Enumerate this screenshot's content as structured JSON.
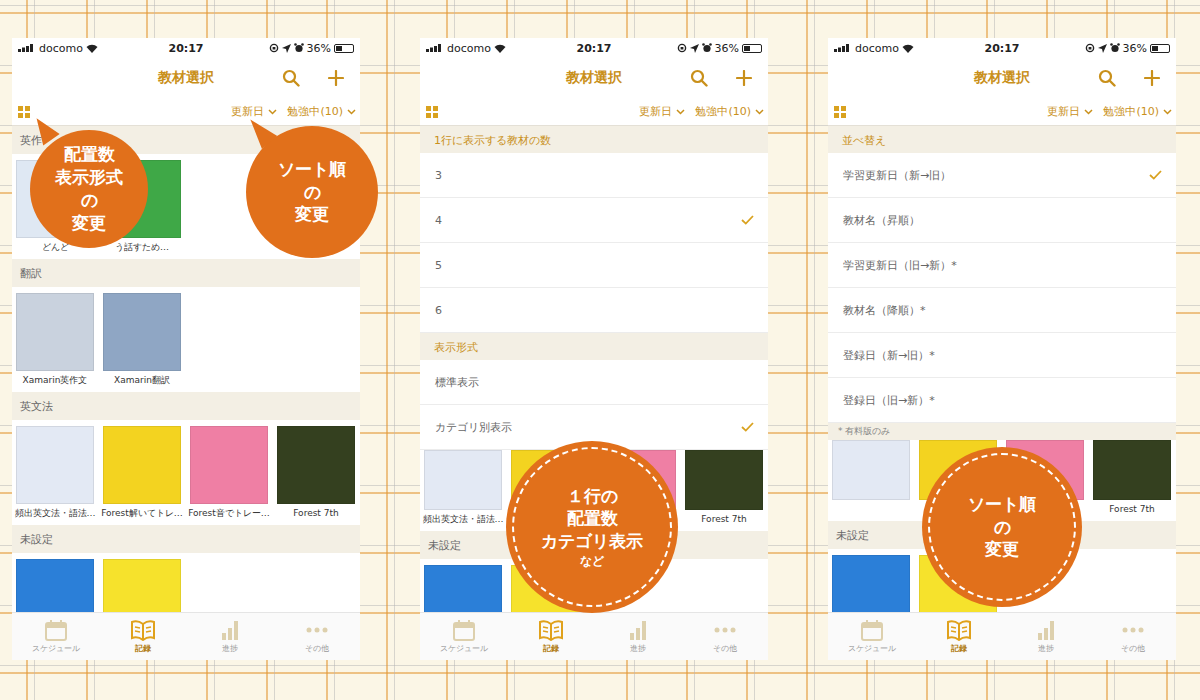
{
  "phones": [
    {
      "status": {
        "carrier": "docomo",
        "time": "20:17",
        "battery": "36%",
        "battery_level": 0.36
      },
      "nav": {
        "title": "教材選択"
      },
      "filters": {
        "sort": "更新日",
        "status": "勉強中(10)"
      },
      "sections": [
        {
          "title": "英作",
          "books": [
            {
              "label": "どんど",
              "color": "#dfe8f3"
            },
            {
              "label": "う話すため…",
              "color": "#3fa847"
            }
          ]
        },
        {
          "title": "翻訳",
          "books": [
            {
              "label": "Xamarin英作文",
              "color": "#c9d2de"
            },
            {
              "label": "Xamarin翻訳",
              "color": "#8fa6c4"
            }
          ]
        },
        {
          "title": "英文法",
          "books": [
            {
              "label": "頻出英文法・語法…",
              "color": "#e3e9f4"
            },
            {
              "label": "Forest解いてトレ…",
              "color": "#f3d320"
            },
            {
              "label": "Forest音でトレー…",
              "color": "#ef7fa4"
            },
            {
              "label": "Forest 7th",
              "color": "#34401f"
            }
          ]
        },
        {
          "title": "未設定",
          "books": [
            {
              "color": "#2b7fd8"
            },
            {
              "color": "#f6e22c"
            }
          ]
        }
      ],
      "tabs": [
        {
          "label": "スケジュール",
          "selected": false
        },
        {
          "label": "記録",
          "selected": true
        },
        {
          "label": "進捗",
          "selected": false
        },
        {
          "label": "その他",
          "selected": false
        }
      ],
      "bubbles": [
        {
          "kind": "solid",
          "lines": [
            {
              "text": "配置数",
              "small": false
            },
            {
              "text": "表示形式",
              "small": false
            },
            {
              "text": "の",
              "small": false
            },
            {
              "text": "変更",
              "small": false
            }
          ]
        },
        {
          "kind": "solid",
          "lines": [
            {
              "text": "ソート順",
              "small": false
            },
            {
              "text": "の",
              "small": false
            },
            {
              "text": "変更",
              "small": false
            }
          ]
        }
      ]
    },
    {
      "status": {
        "carrier": "docomo",
        "time": "20:17",
        "battery": "36%",
        "battery_level": 0.36
      },
      "nav": {
        "title": "教材選択"
      },
      "filters": {
        "sort": "更新日",
        "status": "勉強中(10)"
      },
      "sheet": {
        "groups": [
          {
            "title": "1行に表示する教材の数",
            "options": [
              {
                "label": "3",
                "selected": false
              },
              {
                "label": "4",
                "selected": true
              },
              {
                "label": "5",
                "selected": false
              },
              {
                "label": "6",
                "selected": false
              }
            ]
          },
          {
            "title": "表示形式",
            "options": [
              {
                "label": "標準表示",
                "selected": false
              },
              {
                "label": "カテゴリ別表示",
                "selected": true
              }
            ]
          }
        ]
      },
      "sections": [
        {
          "books": [
            {
              "label": "頻出英文法・語法…",
              "color": "#e3e9f4"
            },
            {
              "color": "#f3d320"
            },
            {
              "color": "#ef7fa4"
            },
            {
              "label": "Forest 7th",
              "color": "#34401f"
            }
          ]
        },
        {
          "title": "未設定",
          "books": [
            {
              "color": "#2b7fd8"
            },
            {
              "color": "#f6e22c"
            }
          ]
        }
      ],
      "tabs": [
        {
          "label": "スケジュール",
          "selected": false
        },
        {
          "label": "記録",
          "selected": true
        },
        {
          "label": "進捗",
          "selected": false
        },
        {
          "label": "その他",
          "selected": false
        }
      ],
      "bubbles": [
        {
          "kind": "dashed",
          "lines": [
            {
              "text": "１行の",
              "small": false
            },
            {
              "text": "配置数",
              "small": false
            },
            {
              "text": "カテゴリ表示",
              "small": false
            },
            {
              "text": "など",
              "small": true
            }
          ]
        }
      ]
    },
    {
      "status": {
        "carrier": "docomo",
        "time": "20:17",
        "battery": "36%",
        "battery_level": 0.36
      },
      "nav": {
        "title": "教材選択"
      },
      "filters": {
        "sort": "更新日",
        "status": "勉強中(10)"
      },
      "sheet": {
        "groups": [
          {
            "title": "並べ替え",
            "options": [
              {
                "label": "学習更新日（新→旧）",
                "selected": true
              },
              {
                "label": "教材名（昇順）",
                "selected": false
              },
              {
                "label": "学習更新日（旧→新）*",
                "selected": false
              },
              {
                "label": "教材名（降順）*",
                "selected": false
              },
              {
                "label": "登録日（新→旧）*",
                "selected": false
              },
              {
                "label": "登録日（旧→新）*",
                "selected": false
              }
            ]
          }
        ],
        "note": "* 有料版のみ"
      },
      "sections": [
        {
          "books": [
            {
              "color": "#e3e9f4"
            },
            {
              "color": "#f3d320"
            },
            {
              "color": "#ef7fa4"
            },
            {
              "label": "Forest 7th",
              "color": "#34401f"
            }
          ]
        },
        {
          "title": "未設定",
          "books": [
            {
              "color": "#2b7fd8"
            },
            {
              "color": "#f6e22c"
            }
          ]
        }
      ],
      "tabs": [
        {
          "label": "スケジュール",
          "selected": false
        },
        {
          "label": "記録",
          "selected": true
        },
        {
          "label": "進捗",
          "selected": false
        },
        {
          "label": "その他",
          "selected": false
        }
      ],
      "bubbles": [
        {
          "kind": "dashed",
          "lines": [
            {
              "text": "ソート順",
              "small": false
            },
            {
              "text": "の",
              "small": false
            },
            {
              "text": "変更",
              "small": false
            }
          ]
        }
      ]
    }
  ]
}
